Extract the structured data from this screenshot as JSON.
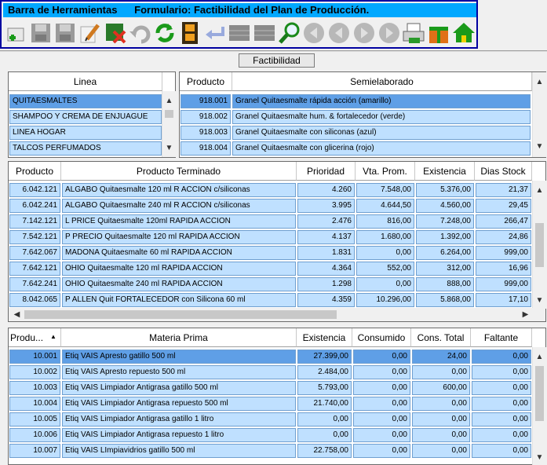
{
  "toolbar": {
    "title": "Barra de Herramientas",
    "form_title": "Formulario: Factibilidad del Plan de Producción.",
    "tools": [
      "add-icon",
      "save-icon",
      "save-as-icon",
      "edit-icon",
      "delete-icon",
      "undo-icon",
      "refresh-icon",
      "film-icon",
      "return-icon",
      "grid-icon",
      "grid-icon",
      "search-icon",
      "first-icon",
      "prev-icon",
      "next-icon",
      "last-icon",
      "print-icon",
      "gift-icon",
      "home-icon"
    ]
  },
  "tab": {
    "label": "Factibilidad"
  },
  "lineas": {
    "header": "Linea",
    "rows": [
      "QUITAESMALTES",
      "SHAMPOO Y CREMA DE ENJUAGUE",
      "LINEA HOGAR",
      "TALCOS PERFUMADOS"
    ]
  },
  "semi": {
    "headers": [
      "Producto",
      "Semielaborado"
    ],
    "rows": [
      [
        "918.001",
        "Granel Quitaesmalte rápida acción (amarillo)"
      ],
      [
        "918.002",
        "Granel Quitaesmalte hum. & fortalecedor (verde)"
      ],
      [
        "918.003",
        "Granel Quitaesmalte con siliconas (azul)"
      ],
      [
        "918.004",
        "Granel Quitaesmalte con glicerina (rojo)"
      ]
    ]
  },
  "terminado": {
    "headers": [
      "Producto",
      "Producto Terminado",
      "Prioridad",
      "Vta. Prom.",
      "Existencia",
      "Dias Stock"
    ],
    "rows": [
      [
        "6.042.121",
        "ALGABO Quitaesmalte 120 ml R ACCION c/siliconas",
        "4.260",
        "7.548,00",
        "5.376,00",
        "21,37"
      ],
      [
        "6.042.241",
        "ALGABO Quitaesmalte 240 ml R ACCION c/siliconas",
        "3.995",
        "4.644,50",
        "4.560,00",
        "29,45"
      ],
      [
        "7.142.121",
        "L PRICE Quitaesmalte 120ml RAPIDA ACCION",
        "2.476",
        "816,00",
        "7.248,00",
        "266,47"
      ],
      [
        "7.542.121",
        "P PRECIO Quitaesmalte 120 ml RAPIDA ACCION",
        "4.137",
        "1.680,00",
        "1.392,00",
        "24,86"
      ],
      [
        "7.642.067",
        "MADONA Quitaesmalte 60 ml RAPIDA ACCION",
        "1.831",
        "0,00",
        "6.264,00",
        "999,00"
      ],
      [
        "7.642.121",
        "OHIO Quitaesmalte 120 ml RAPIDA ACCION",
        "4.364",
        "552,00",
        "312,00",
        "16,96"
      ],
      [
        "7.642.241",
        "OHIO Quitaesmalte 240 ml RAPIDA ACCION",
        "1.298",
        "0,00",
        "888,00",
        "999,00"
      ],
      [
        "8.042.065",
        "P ALLEN Quit FORTALECEDOR con Silicona 60 ml",
        "4.359",
        "10.296,00",
        "5.868,00",
        "17,10"
      ]
    ]
  },
  "materia": {
    "headers": [
      "Produ...",
      "Materia Prima",
      "Existencia",
      "Consumido",
      "Cons. Total",
      "Faltante"
    ],
    "rows": [
      [
        "10.001",
        "Etiq VAIS Apresto gatillo 500 ml",
        "27.399,00",
        "0,00",
        "24,00",
        "0,00"
      ],
      [
        "10.002",
        "Etiq VAIS Apresto repuesto 500 ml",
        "2.484,00",
        "0,00",
        "0,00",
        "0,00"
      ],
      [
        "10.003",
        "Etiq VAIS Limpiador Antigrasa gatillo 500 ml",
        "5.793,00",
        "0,00",
        "600,00",
        "0,00"
      ],
      [
        "10.004",
        "Etiq VAIS Limpiador Antigrasa repuesto 500 ml",
        "21.740,00",
        "0,00",
        "0,00",
        "0,00"
      ],
      [
        "10.005",
        "Etiq VAIS Limpiador Antigrasa gatillo 1 litro",
        "0,00",
        "0,00",
        "0,00",
        "0,00"
      ],
      [
        "10.006",
        "Etiq VAIS Limpiador Antigrasa repuesto 1 litro",
        "0,00",
        "0,00",
        "0,00",
        "0,00"
      ],
      [
        "10.007",
        "Etiq VAIS LImpiavidrios gatillo 500 ml",
        "22.758,00",
        "0,00",
        "0,00",
        "0,00"
      ]
    ]
  }
}
